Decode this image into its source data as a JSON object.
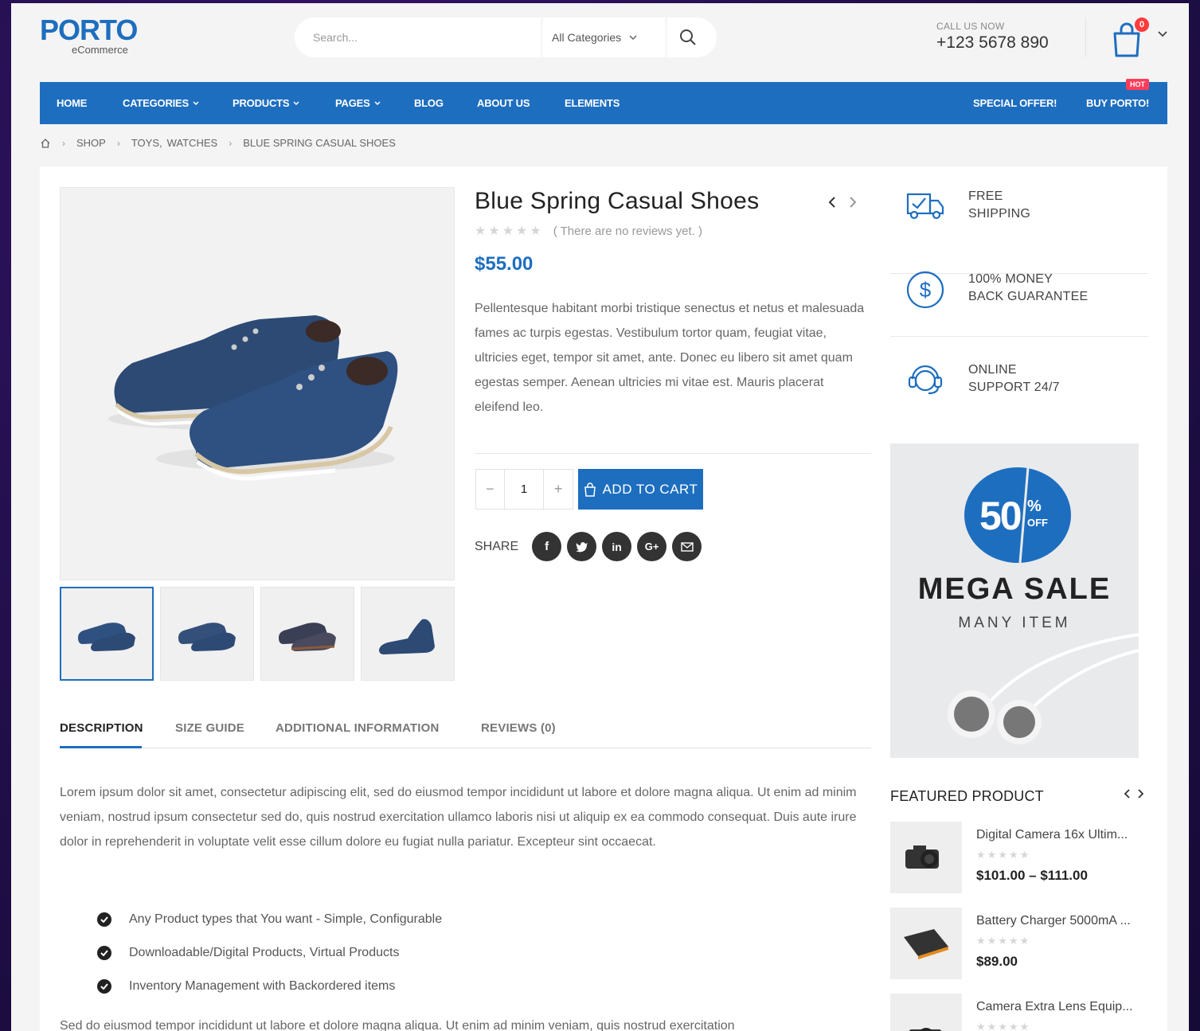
{
  "brand": {
    "logo": "PORTO",
    "sub": "eCommerce",
    "accent": "#1e6ebf"
  },
  "search": {
    "placeholder": "Search...",
    "category": "All Categories"
  },
  "contact": {
    "label": "CALL US NOW",
    "number": "+123 5678 890"
  },
  "cart": {
    "count": "0"
  },
  "nav": {
    "items": [
      "HOME",
      "CATEGORIES",
      "PRODUCTS",
      "PAGES",
      "BLOG",
      "ABOUT US",
      "ELEMENTS"
    ],
    "right": [
      "SPECIAL OFFER!",
      "BUY PORTO!"
    ],
    "hot_badge": "HOT"
  },
  "breadcrumb": {
    "items": [
      "SHOP",
      "TOYS,",
      "WATCHES",
      "BLUE SPRING CASUAL SHOES"
    ]
  },
  "product": {
    "title": "Blue Spring Casual Shoes",
    "reviews_note": "( There are no reviews yet. )",
    "price": "$55.00",
    "description": "Pellentesque habitant morbi tristique senectus et netus et malesuada fames ac turpis egestas. Vestibulum tortor quam, feugiat vitae, ultricies eget, tempor sit amet, ante. Donec eu libero sit amet quam egestas semper. Aenean ultricies mi vitae est. Mauris placerat eleifend leo.",
    "qty": "1",
    "add_to_cart": "ADD TO CART",
    "share_label": "SHARE"
  },
  "tabs": [
    "DESCRIPTION",
    "SIZE GUIDE",
    "ADDITIONAL INFORMATION",
    "REVIEWS (0)"
  ],
  "details": {
    "paragraph": "Lorem ipsum dolor sit amet, consectetur adipiscing elit, sed do eiusmod tempor incididunt ut labore et dolore magna aliqua. Ut enim ad minim veniam, nostrud ipsum consectetur sed do, quis nostrud exercitation ullamco laboris nisi ut aliquip ex ea commodo consequat. Duis aute irure dolor in reprehenderit in voluptate velit esse cillum dolore eu fugiat nulla pariatur. Excepteur sint occaecat.",
    "checks": [
      "Any Product types that You want - Simple, Configurable",
      "Downloadable/Digital Products, Virtual Products",
      "Inventory Management with Backordered items"
    ],
    "paragraph2": "Sed do eiusmod tempor incididunt ut labore et dolore magna aliqua. Ut enim ad minim veniam, quis nostrud exercitation"
  },
  "features": [
    {
      "line1": "FREE",
      "line2": "SHIPPING"
    },
    {
      "line1": "100% MONEY",
      "line2": "BACK GUARANTEE"
    },
    {
      "line1": "ONLINE",
      "line2": "SUPPORT 24/7"
    }
  ],
  "promo": {
    "percent": "50",
    "pct": "%",
    "off": "OFF",
    "title": "MEGA SALE",
    "subtitle": "MANY ITEM"
  },
  "featured": {
    "title": "FEATURED PRODUCT",
    "items": [
      {
        "name": "Digital Camera 16x Ultim...",
        "price": "$101.00 – $111.00"
      },
      {
        "name": "Battery Charger 5000mA ...",
        "price": "$89.00"
      },
      {
        "name": "Camera Extra Lens Equip...",
        "price": ""
      }
    ]
  }
}
